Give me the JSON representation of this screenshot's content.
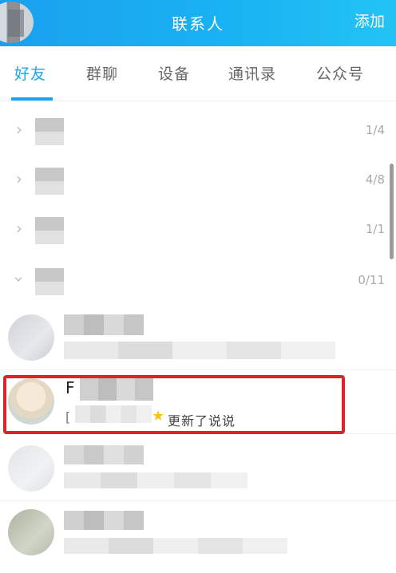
{
  "header": {
    "title": "联系人",
    "add_label": "添加"
  },
  "tabs": [
    "好友",
    "群聊",
    "设备",
    "通讯录",
    "公众号"
  ],
  "active_tab": "好友",
  "groups": [
    {
      "count": "1/4",
      "expanded": false
    },
    {
      "count": "4/8",
      "expanded": false
    },
    {
      "count": "1/1",
      "expanded": false
    },
    {
      "count": "0/11",
      "expanded": true
    }
  ],
  "highlighted_contact": {
    "name_visible": "F",
    "status_prefix": "[",
    "status_text": "更新了说说",
    "status_icon": "star-icon"
  },
  "colors": {
    "header": "#1aa0ee",
    "accent": "#1aa6ee",
    "highlight_border": "#e0202a",
    "star": "#f5c51e"
  }
}
